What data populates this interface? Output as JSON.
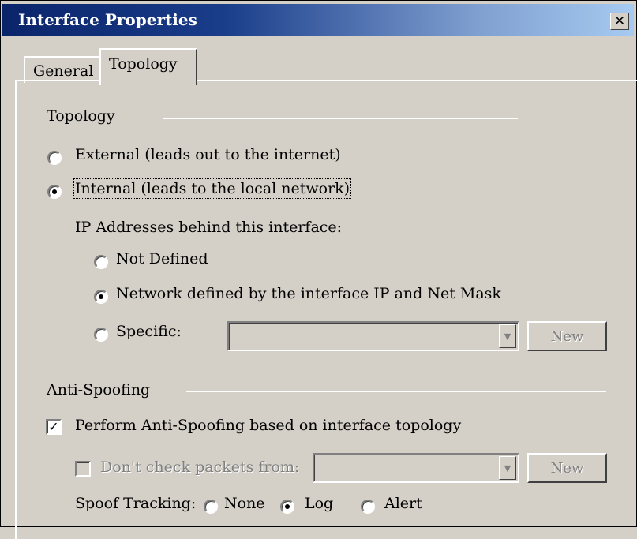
{
  "window": {
    "title": "Interface Properties",
    "close_glyph": "✕"
  },
  "tabs": [
    {
      "label": "General",
      "selected": false
    },
    {
      "label": "Topology",
      "selected": true
    }
  ],
  "topology": {
    "group_label": "Topology",
    "external_label": "External (leads out to the internet)",
    "external_checked": false,
    "internal_label": "Internal (leads to the local network)",
    "internal_checked": true,
    "ip_addresses_label": "IP Addresses behind this interface:",
    "not_defined_label": "Not Defined",
    "not_defined_checked": false,
    "network_defined_label": "Network defined by the interface IP and Net Mask",
    "network_defined_checked": true,
    "specific_label": "Specific:",
    "specific_checked": false,
    "specific_value": "",
    "new_button_label": "New"
  },
  "anti_spoofing": {
    "group_label": "Anti-Spoofing",
    "perform_label": "Perform Anti-Spoofing based on interface topology",
    "perform_checked": true,
    "dont_check_label": "Don't check packets from:",
    "dont_check_checked": false,
    "dont_check_value": "",
    "new_button_label": "New",
    "spoof_tracking_label": "Spoof Tracking:",
    "tracking_options": [
      {
        "label": "None",
        "checked": false
      },
      {
        "label": "Log",
        "checked": true
      },
      {
        "label": "Alert",
        "checked": false
      }
    ]
  },
  "icons": {
    "close": "close-icon",
    "dropdown": "chevron-down-icon",
    "check": "checkmark-icon"
  },
  "colors": {
    "title_gradient_start": "#0a246a",
    "title_gradient_end": "#a6caf0",
    "face": "#d4d0c8"
  }
}
